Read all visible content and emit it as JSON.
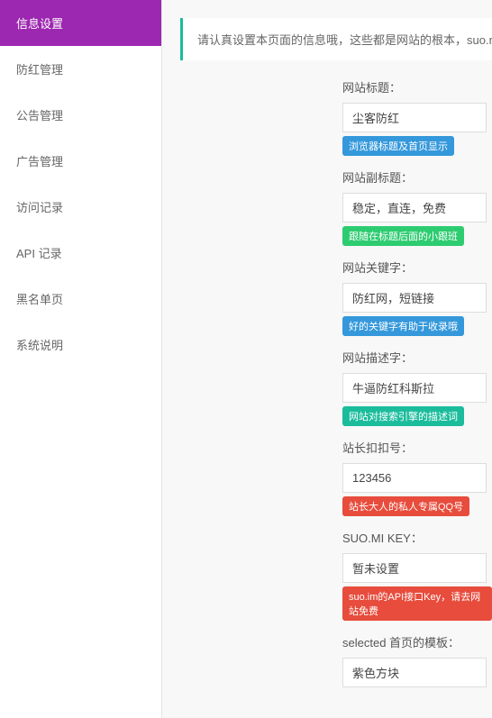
{
  "sidebar": {
    "items": [
      {
        "label": "信息设置",
        "active": true
      },
      {
        "label": "防红管理",
        "active": false
      },
      {
        "label": "公告管理",
        "active": false
      },
      {
        "label": "广告管理",
        "active": false
      },
      {
        "label": "访问记录",
        "active": false
      },
      {
        "label": "API 记录",
        "active": false
      },
      {
        "label": "黑名单页",
        "active": false
      },
      {
        "label": "系统说明",
        "active": false
      }
    ]
  },
  "notice": "请认真设置本页面的信息哦，这些都是网站的根本，suo.mi的key直接去",
  "form": {
    "title": {
      "label": "网站标题：",
      "value": "尘客防红",
      "hint": "浏览器标题及首页显示",
      "hintClass": "hint-blue"
    },
    "subtitle": {
      "label": "网站副标题：",
      "value": "稳定，直连，免费",
      "hint": "跟随在标题后面的小跟班",
      "hintClass": "hint-green"
    },
    "keywords": {
      "label": "网站关键字：",
      "value": "防红网，短链接",
      "hint": "好的关键字有助于收录哦",
      "hintClass": "hint-blue"
    },
    "description": {
      "label": "网站描述字：",
      "value": "牛逼防红科斯拉",
      "hint": "网站对搜索引擎的描述词",
      "hintClass": "hint-teal"
    },
    "qq": {
      "label": "站长扣扣号：",
      "value": "123456",
      "hint": "站长大人的私人专属QQ号",
      "hintClass": "hint-red"
    },
    "suomikey": {
      "label": "SUO.MI KEY：",
      "value": "暂未设置",
      "hint": "suo.im的API接口Key，请去网站免费",
      "hintClass": "hint-red"
    },
    "template": {
      "label": "selected 首页的模板：",
      "value": "紫色方块"
    }
  }
}
